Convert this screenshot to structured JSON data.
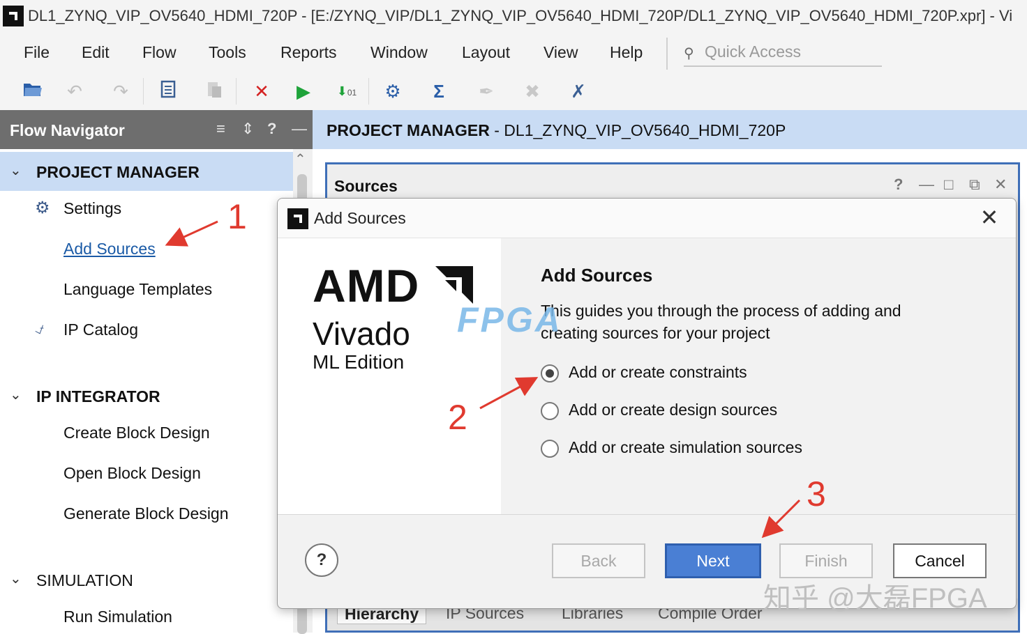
{
  "window": {
    "title": "DL1_ZYNQ_VIP_OV5640_HDMI_720P - [E:/ZYNQ_VIP/DL1_ZYNQ_VIP_OV5640_HDMI_720P/DL1_ZYNQ_VIP_OV5640_HDMI_720P.xpr] - Vi"
  },
  "menu": {
    "file": "File",
    "edit": "Edit",
    "flow": "Flow",
    "tools": "Tools",
    "reports": "Reports",
    "window": "Window",
    "layout": "Layout",
    "view": "View",
    "help": "Help"
  },
  "quick_access": {
    "placeholder": "Quick Access"
  },
  "flow_navigator": {
    "title": "Flow Navigator",
    "project_manager": {
      "label": "PROJECT MANAGER",
      "settings": "Settings",
      "add_sources": "Add Sources",
      "language_templates": "Language Templates",
      "ip_catalog": "IP Catalog"
    },
    "ip_integrator": {
      "label": "IP INTEGRATOR",
      "create_block_design": "Create Block Design",
      "open_block_design": "Open Block Design",
      "generate_block_design": "Generate Block Design"
    },
    "simulation": {
      "label": "SIMULATION",
      "run_simulation": "Run Simulation"
    }
  },
  "project_manager": {
    "title_bold": "PROJECT MANAGER",
    "title_rest": " - DL1_ZYNQ_VIP_OV5640_HDMI_720P"
  },
  "sources_panel": {
    "title": "Sources",
    "tabs": {
      "hierarchy": "Hierarchy",
      "ip_sources": "IP Sources",
      "libraries": "Libraries",
      "compile_order": "Compile Order"
    }
  },
  "dialog": {
    "title": "Add Sources",
    "brand": {
      "amd": "AMD",
      "vivado": "Vivado",
      "edition": "ML Edition"
    },
    "heading": "Add Sources",
    "description": "This guides you through the process of adding and creating sources for your project",
    "options": {
      "constraints": "Add or create constraints",
      "design": "Add or create design sources",
      "simulation": "Add or create simulation sources",
      "selected": "constraints"
    },
    "buttons": {
      "help": "?",
      "back": "Back",
      "next": "Next",
      "finish": "Finish",
      "cancel": "Cancel"
    }
  },
  "annotations": {
    "step1": "1",
    "step2": "2",
    "step3": "3",
    "color": "#e03a2f"
  },
  "watermark": {
    "text": "知乎 @大磊FPGA",
    "overlay": "FPGA"
  }
}
